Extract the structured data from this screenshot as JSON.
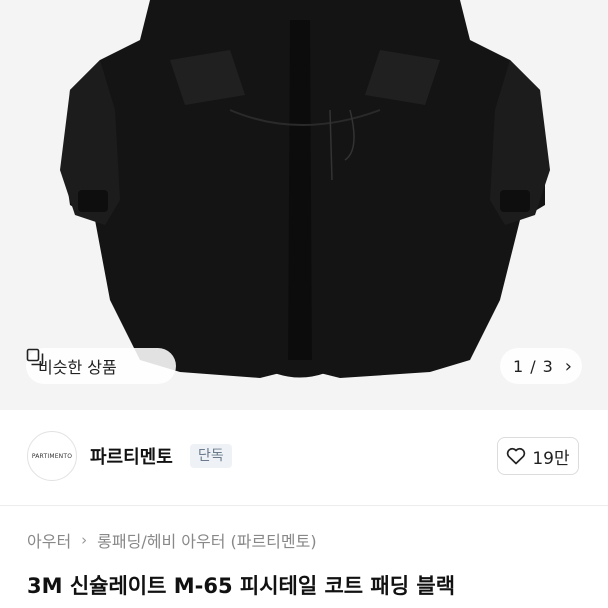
{
  "hero": {
    "similar_label": "비슷한 상품",
    "pager": {
      "current": "1",
      "separator": "/",
      "total": "3"
    }
  },
  "brand": {
    "logo_text": "PARTIMENTO",
    "name": "파르티멘토",
    "badge": "단독",
    "like_count": "19만"
  },
  "breadcrumb": {
    "items": [
      "아우터",
      "롱패딩/헤비 아우터 (파르티멘토)"
    ]
  },
  "product": {
    "title": "3M 신슐레이트 M-65 피시테일 코트 패딩 블랙"
  },
  "colors": {
    "accent_badge_bg": "#eef1f5",
    "accent_badge_text": "#6b7b8c"
  }
}
